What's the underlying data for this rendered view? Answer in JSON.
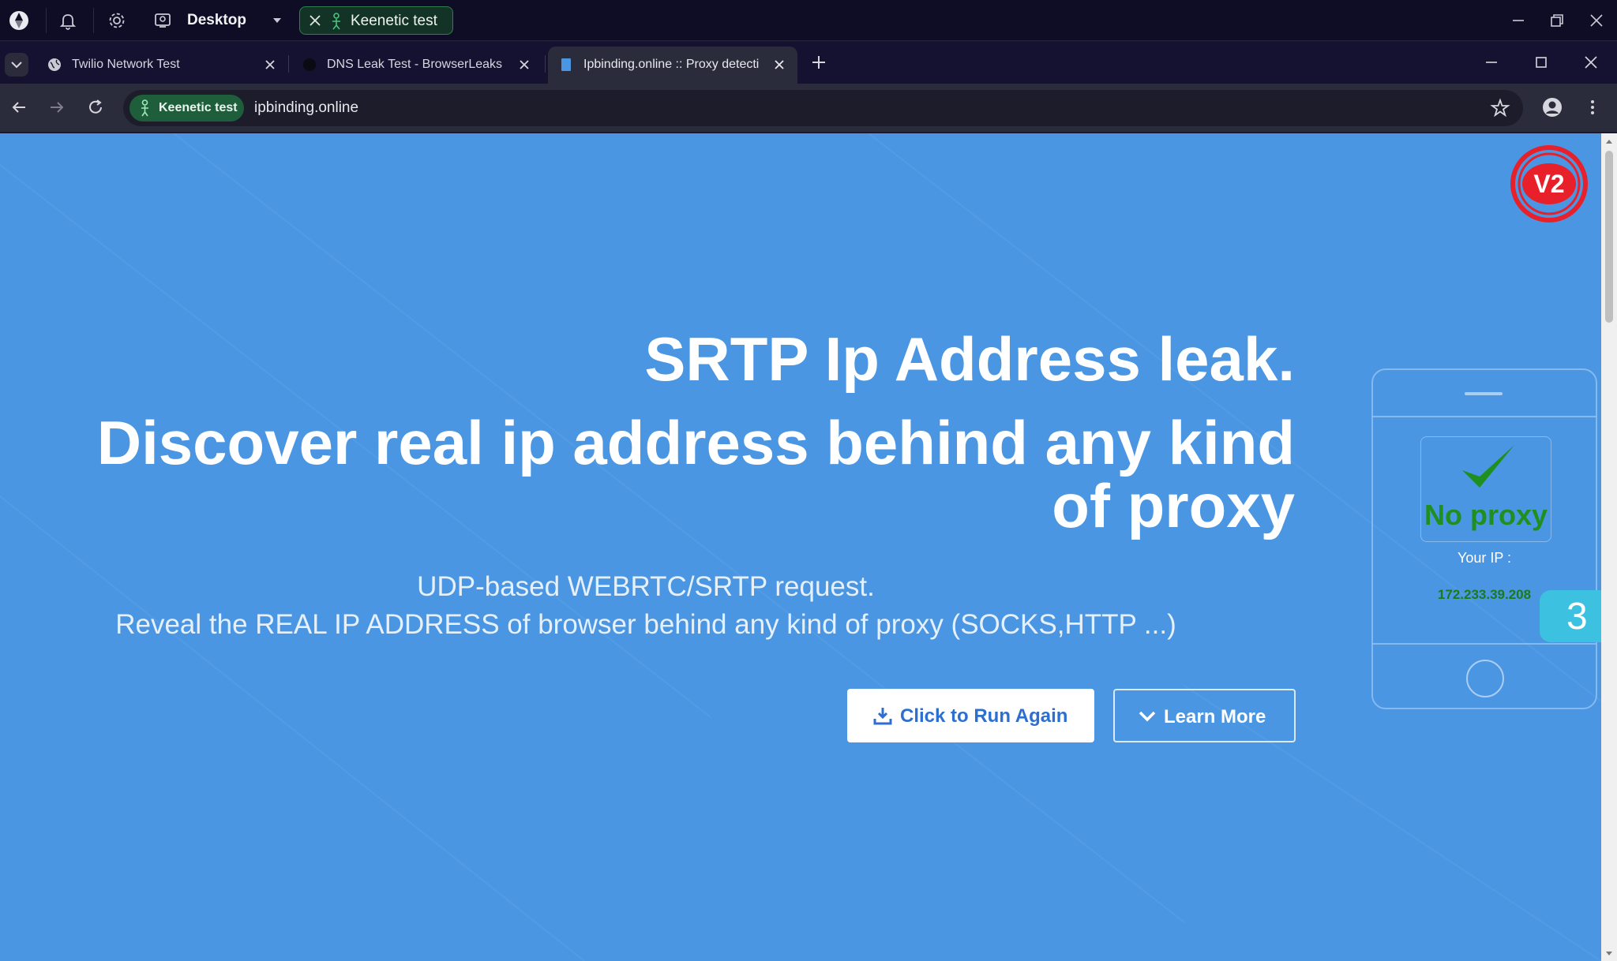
{
  "os_bar": {
    "workspace_label": "Desktop",
    "profile_name": "Keenetic test"
  },
  "tabs": [
    {
      "title": "Twilio Network Test",
      "active": false
    },
    {
      "title": "DNS Leak Test - BrowserLeaks",
      "active": false
    },
    {
      "title": "Ipbinding.online :: Proxy detecti",
      "active": true
    }
  ],
  "address_bar": {
    "profile_chip": "Keenetic test",
    "url": "ipbinding.online"
  },
  "hero": {
    "title": "SRTP Ip Address leak.",
    "headline": "Discover real ip address behind any kind of proxy",
    "subtitle_1": "UDP-based WEBRTC/SRTP request.",
    "subtitle_2": "Reveal the REAL IP ADDRESS of browser behind any kind of proxy (SOCKS,HTTP ...)",
    "run_button": "Click to Run Again",
    "learn_button": "Learn More"
  },
  "logo_text": "V2",
  "phone_widget": {
    "status": "No proxy",
    "ip_label": "Your IP :",
    "ip_value": "172.233.39.208"
  },
  "side_badge": "3",
  "colors": {
    "page_bg": "#4a96e2",
    "status_green": "#1f8f1f",
    "logo_red": "#e8202a",
    "badge_cyan": "#3cc2e0"
  }
}
